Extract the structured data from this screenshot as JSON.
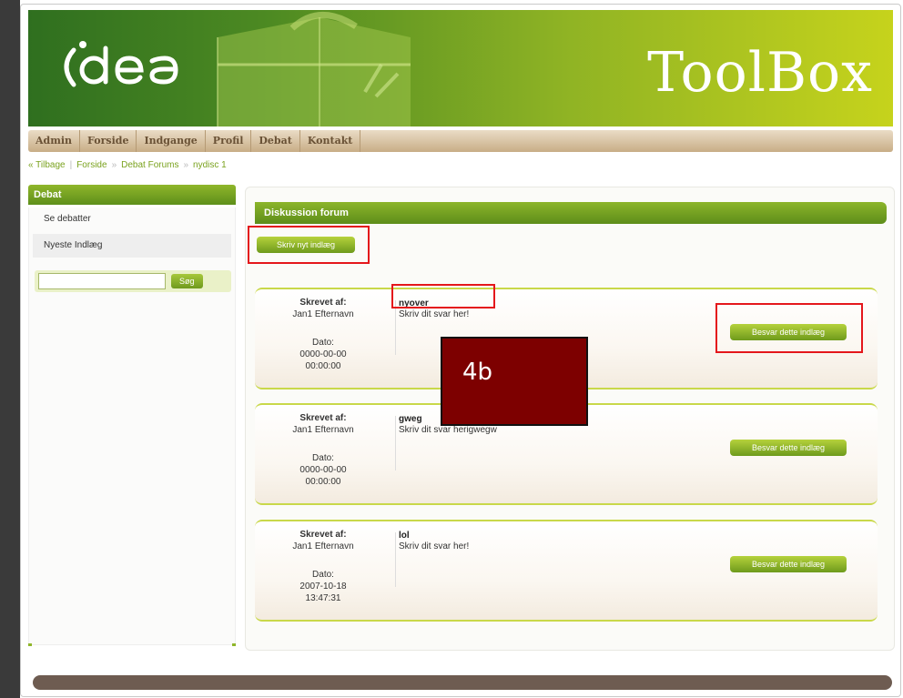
{
  "header": {
    "brand": "ToolBox",
    "logo_text": "idea"
  },
  "nav": {
    "items": [
      "Admin",
      "Forside",
      "Indgange",
      "Profil",
      "Debat",
      "Kontakt"
    ]
  },
  "breadcrumb": {
    "back": "« Tilbage",
    "items": [
      "Forside",
      "Debat Forums",
      "nydisc 1"
    ],
    "separator": "»"
  },
  "sidebar": {
    "title": "Debat",
    "items": [
      "Se debatter",
      "Nyeste Indlæg"
    ],
    "search_button": "Søg",
    "search_value": ""
  },
  "forum": {
    "title": "Diskussion forum",
    "new_post_button": "Skriv nyt indlæg",
    "posts": [
      {
        "author_label": "Skrevet af:",
        "author": "Jan1 Efternavn",
        "date_label": "Dato:",
        "date": "0000-00-00",
        "time": "00:00:00",
        "title": "nyover",
        "text": "Skriv dit svar her!",
        "reply_button": "Besvar dette indlæg"
      },
      {
        "author_label": "Skrevet af:",
        "author": "Jan1 Efternavn",
        "date_label": "Dato:",
        "date": "0000-00-00",
        "time": "00:00:00",
        "title": "gweg",
        "text": "Skriv dit svar herigwegw",
        "reply_button": "Besvar dette indlæg"
      },
      {
        "author_label": "Skrevet af:",
        "author": "Jan1 Efternavn",
        "date_label": "Dato:",
        "date": "2007-10-18",
        "time": "13:47:31",
        "title": "lol",
        "text": "Skriv dit svar her!",
        "reply_button": "Besvar dette indlæg"
      }
    ]
  },
  "annotation": {
    "label": "4b"
  },
  "colors": {
    "brand_green": "#5e8f1b",
    "highlight_red": "#e4171c",
    "label_bg": "#7d0000"
  }
}
